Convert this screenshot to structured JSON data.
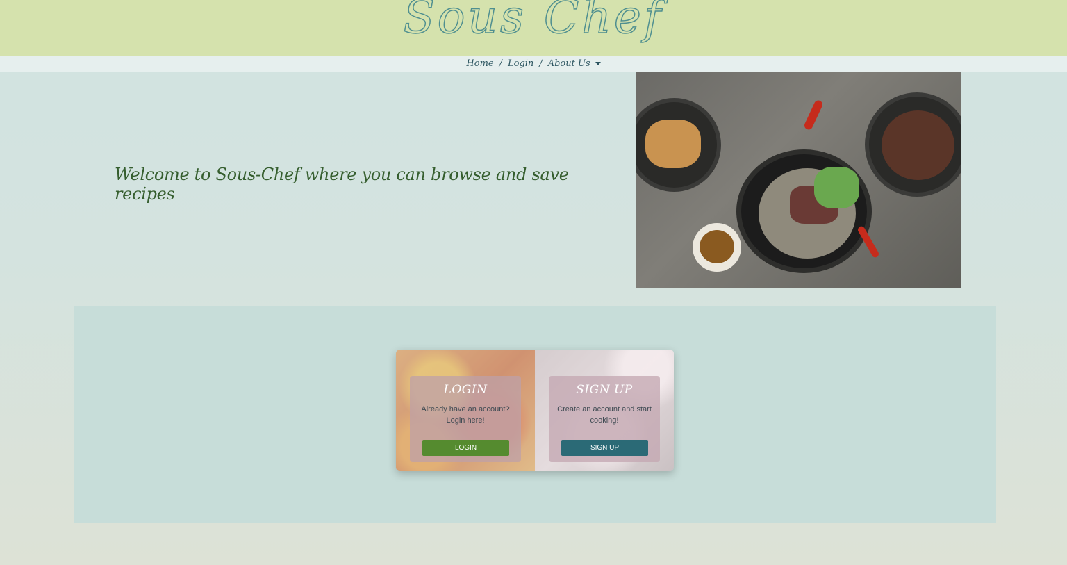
{
  "header": {
    "logo_text": "Sous Chef"
  },
  "nav": {
    "items": [
      "Home",
      "Login",
      "About Us"
    ],
    "separator": "/"
  },
  "hero": {
    "welcome_text": "Welcome to Sous-Chef where you can browse and save recipes",
    "image_alt": "food-bowls-photo"
  },
  "cards": {
    "login": {
      "title": "LOGIN",
      "text": "Already have an account? Login here!",
      "button": "LOGIN"
    },
    "signup": {
      "title": "SIGN UP",
      "text": "Create an account and start cooking!",
      "button": "SIGN UP"
    }
  },
  "colors": {
    "header_bg": "#d5e2ad",
    "nav_bg": "#e6efee",
    "login_button": "#558b2f",
    "signup_button": "#2b6a76",
    "welcome_text": "#355e2e"
  }
}
